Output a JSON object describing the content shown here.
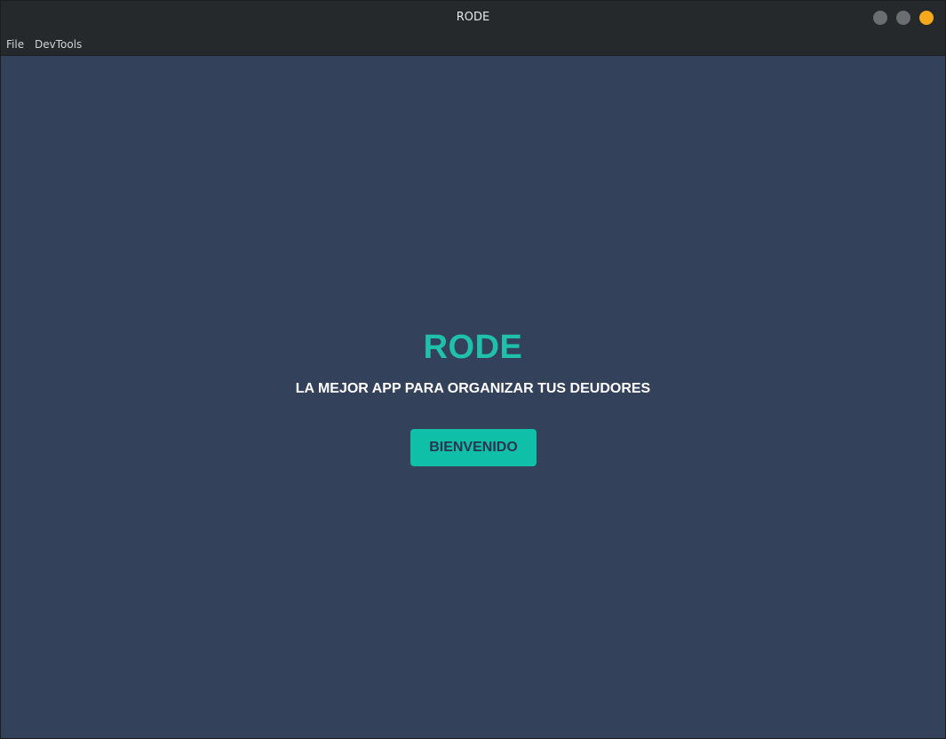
{
  "window": {
    "title": "RODE",
    "controls": [
      {
        "name": "window-control-1",
        "color": "#6b6e70"
      },
      {
        "name": "window-control-2",
        "color": "#6b6e70"
      },
      {
        "name": "window-control-3",
        "color": "#f5a91b"
      }
    ]
  },
  "menu": {
    "file_label": "File",
    "devtools_label": "DevTools"
  },
  "hero": {
    "title": "RODE",
    "subtitle": "LA MEJOR APP PARA ORGANIZAR TUS DEUDORES",
    "button_label": "BIENVENIDO"
  },
  "colors": {
    "accent": "#1fc1ad",
    "button_bg": "#10bfa7",
    "button_text": "#2a3550",
    "background": "#33415a"
  }
}
